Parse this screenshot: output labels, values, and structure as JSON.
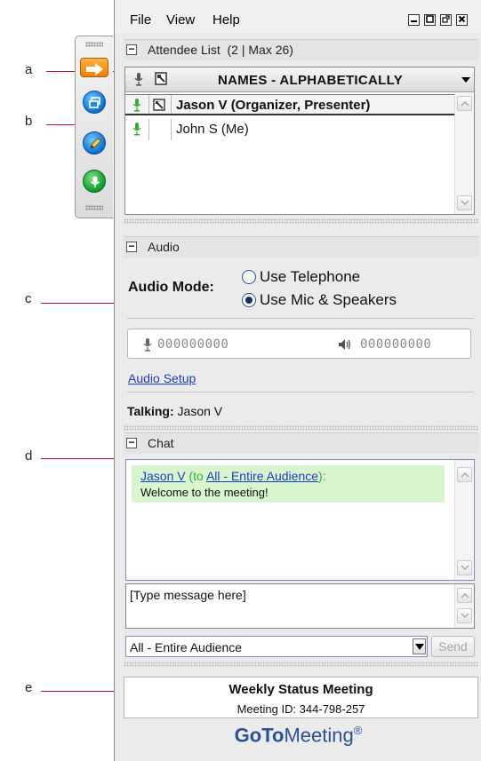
{
  "callouts": [
    "a",
    "b",
    "c",
    "d",
    "e"
  ],
  "menu": {
    "file": "File",
    "view": "View",
    "help": "Help"
  },
  "window_controls": {
    "minimize": "_",
    "maximize": "□",
    "popout": "⧉",
    "close": "×"
  },
  "attendee_panel": {
    "title": "Attendee List",
    "count": "(2 | Max 26)",
    "sort_label": "NAMES - ALPHABETICALLY",
    "rows": [
      {
        "name": "Jason V (Organizer, Presenter)",
        "bold": true
      },
      {
        "name": "John S (Me)",
        "bold": false
      }
    ]
  },
  "audio_panel": {
    "title": "Audio",
    "mode_label": "Audio Mode:",
    "options": [
      {
        "label": "Use Telephone",
        "selected": false
      },
      {
        "label": "Use Mic & Speakers",
        "selected": true
      }
    ],
    "mic_level": "000000000",
    "speaker_level": "000000000",
    "setup_link": "Audio Setup",
    "talking_label": "Talking:",
    "talking_name": "Jason V"
  },
  "chat_panel": {
    "title": "Chat",
    "message": {
      "sender": "Jason V",
      "to_prefix": "(to",
      "recipient": "All - Entire Audience",
      "to_suffix": "):",
      "text": "Welcome to the meeting!"
    },
    "input_placeholder": "[Type message here]",
    "audience": "All - Entire Audience",
    "send_label": "Send"
  },
  "meeting": {
    "title": "Weekly Status Meeting",
    "id_text": "Meeting ID: 344-798-257"
  },
  "brand": {
    "goto": "GoTo",
    "meeting": "Meeting",
    "reg": "®"
  },
  "colors": {
    "accent_blue": "#2b4f98",
    "link": "#1a3cc7",
    "callout_line": "#c8102e",
    "chat_bg": "#d9f5d0",
    "mic_green": "#3aaa3a"
  }
}
